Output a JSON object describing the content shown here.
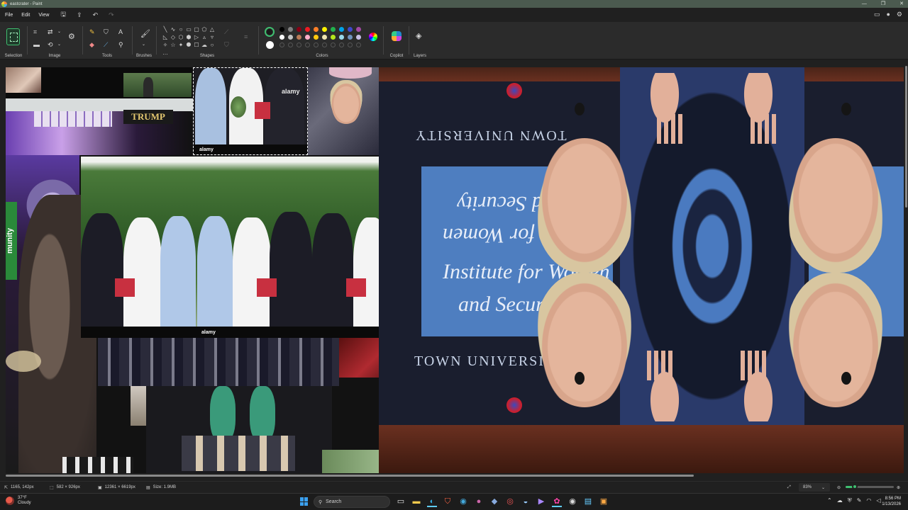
{
  "window": {
    "title": "eastcrater - Paint",
    "controls": [
      "—",
      "❐",
      "✕"
    ]
  },
  "menu": {
    "items": [
      "File",
      "Edit",
      "View"
    ],
    "quick_icons": [
      "save-icon",
      "share-icon",
      "undo-icon",
      "redo-icon"
    ]
  },
  "ribbon": {
    "groups": {
      "selection": "Selection",
      "image": "Image",
      "tools": "Tools",
      "brushes": "Brushes",
      "shapes": "Shapes",
      "colors": "Colors",
      "copilot": "Copilot",
      "layers": "Layers"
    },
    "shape_glyphs": [
      "╲",
      "∿",
      "○",
      "▭",
      "▢",
      "⬠",
      "△",
      "◺",
      "◇",
      "⬡",
      "⬢",
      "▷",
      "▵",
      "▿",
      "✧",
      "☆",
      "✦",
      "⯃",
      "☐",
      "☁",
      "○",
      "…"
    ],
    "primary_color": "#1a1a1a",
    "secondary_color": "#ffffff",
    "palette_row1": [
      "#000000",
      "#7f7f7f",
      "#880015",
      "#ed1c24",
      "#ff7f27",
      "#fff200",
      "#22b14c",
      "#00a2e8",
      "#3f48cc",
      "#a349a4"
    ],
    "palette_row2": [
      "#ffffff",
      "#c3c3c3",
      "#b97a57",
      "#ffaec9",
      "#ffc90e",
      "#efe4b0",
      "#b5e61d",
      "#99d9ea",
      "#7092be",
      "#c8bfe7"
    ]
  },
  "canvas": {
    "watermarks": [
      "alamy",
      "alamy",
      "alamy",
      "alamy"
    ],
    "poster_text": [
      "Institute for Women",
      "and Security",
      "TOWN UNIVERSITY"
    ],
    "sign_text": "TRUMP",
    "side_text": "munity"
  },
  "status": {
    "cursor": "1165, 142px",
    "selection": "582 × 926px",
    "canvas_size": "12361 × 6619px",
    "file_size": "Size: 1.9MB",
    "zoom": "83%"
  },
  "taskbar": {
    "weather_temp": "37°F",
    "weather_desc": "Cloudy",
    "search_placeholder": "Search",
    "time": "8:56 PM",
    "date": "1/13/2026"
  },
  "colors": {
    "accent": "#3fbf70",
    "titlebar": "#4b5a4f"
  }
}
